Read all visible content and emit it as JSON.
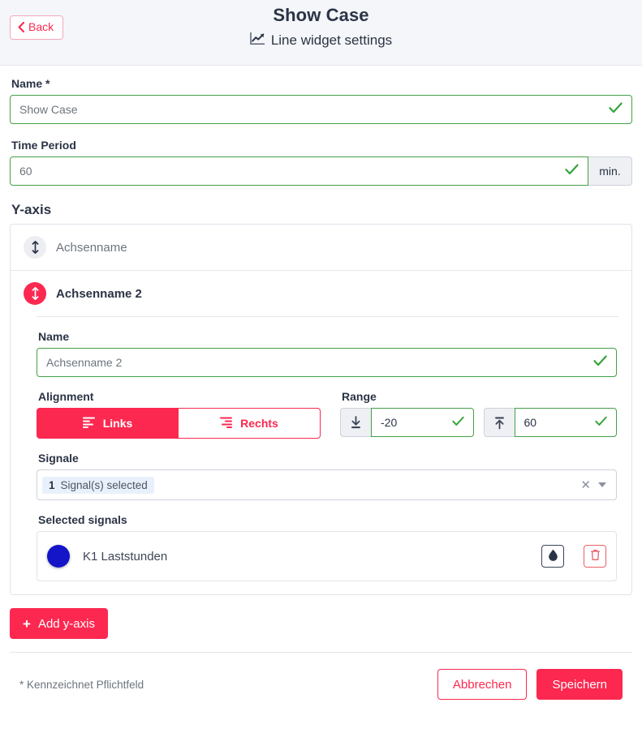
{
  "header": {
    "back_label": "Back",
    "back_icon": "chevron-left-icon",
    "title": "Show Case",
    "subtitle": "Line widget settings",
    "subtitle_icon": "line-chart-icon"
  },
  "form": {
    "name": {
      "label": "Name *",
      "value": "Show Case",
      "placeholder": "Show Case",
      "valid_icon": "check-icon"
    },
    "time_period": {
      "label": "Time Period",
      "value": "60",
      "placeholder": "60",
      "unit": "min.",
      "valid_icon": "check-icon"
    }
  },
  "yaxis": {
    "section_label": "Y-axis",
    "items": [
      {
        "name": "Achsenname",
        "expanded": false,
        "handle_icon": "drag-vertical-icon"
      },
      {
        "name": "Achsenname 2",
        "expanded": true,
        "handle_icon": "drag-vertical-icon"
      }
    ],
    "panel": {
      "name": {
        "label": "Name",
        "value": "Achsenname 2",
        "placeholder": "Achsenname 2",
        "valid_icon": "check-icon"
      },
      "alignment": {
        "label": "Alignment",
        "options": [
          {
            "label": "Links",
            "icon": "align-left-icon",
            "selected": true
          },
          {
            "label": "Rechts",
            "icon": "align-right-icon",
            "selected": false
          }
        ]
      },
      "range": {
        "label": "Range",
        "min": {
          "value": "-20",
          "icon": "arrow-down-to-line-icon",
          "valid_icon": "check-icon"
        },
        "max": {
          "value": "60",
          "icon": "arrow-up-to-line-icon",
          "valid_icon": "check-icon"
        }
      },
      "signals": {
        "label": "Signale",
        "chip_count": "1",
        "chip_text": "Signal(s) selected",
        "clear_icon": "close-icon",
        "caret_icon": "chevron-down-icon"
      },
      "selected_signals": {
        "label": "Selected signals",
        "rows": [
          {
            "color": "#1414c8",
            "name": "K1 Laststunden",
            "color_icon": "droplet-icon",
            "delete_icon": "trash-icon"
          }
        ]
      }
    },
    "add_button": {
      "label": "Add y-axis",
      "icon": "plus-icon"
    }
  },
  "footer": {
    "required_note": "* Kennzeichnet Pflichtfeld",
    "cancel_label": "Abbrechen",
    "save_label": "Speichern"
  },
  "colors": {
    "accent": "#fc2850",
    "valid": "#36a33b",
    "header_bg": "#f4f6f9"
  }
}
